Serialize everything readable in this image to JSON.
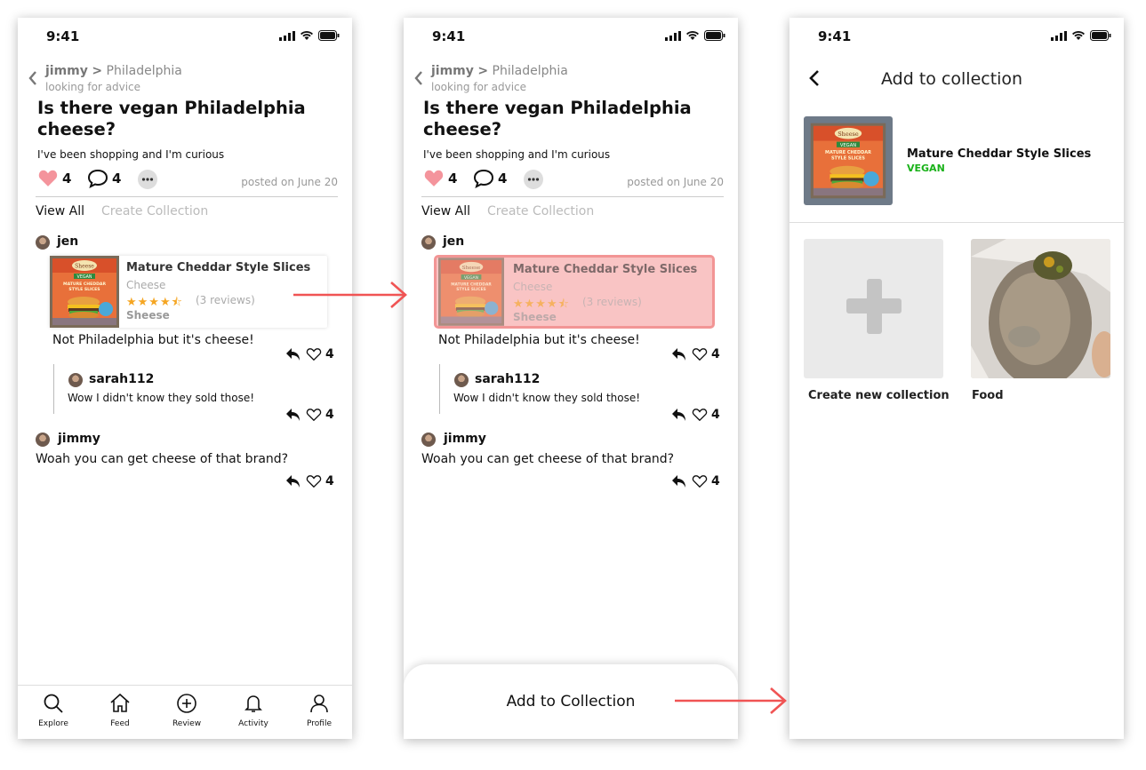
{
  "status": {
    "time": "9:41"
  },
  "post": {
    "author": "jimmy",
    "separator": ">",
    "community": "Philadelphia",
    "subtitle": "looking for advice",
    "title": "Is there vegan Philadelphia cheese?",
    "body": "I've been shopping and I'm curious",
    "likes": "4",
    "comments": "4",
    "posted": "posted on June 20"
  },
  "tabs": {
    "view_all": "View All",
    "create_collection": "Create Collection"
  },
  "comments": [
    {
      "user": "jen",
      "text": "Not Philadelphia but it's cheese!",
      "likes": "4"
    },
    {
      "user": "sarah112",
      "text": "Wow I didn't know they sold those!",
      "likes": "4"
    },
    {
      "user": "jimmy",
      "text": "Woah you can get cheese of that brand?",
      "likes": "4"
    }
  ],
  "product": {
    "name": "Mature Cheddar Style Slices",
    "category": "Cheese",
    "rating": 4.5,
    "stars": "★★★★⯪",
    "reviews": "(3 reviews)",
    "brand": "Sheese",
    "package": {
      "brand": "Sheese",
      "tag": "VEGAN",
      "line1": "MATURE CHEDDAR",
      "line2": "STYLE SLICES"
    }
  },
  "tabbar": [
    {
      "label": "Explore",
      "icon": "search-icon"
    },
    {
      "label": "Feed",
      "icon": "home-icon"
    },
    {
      "label": "Review",
      "icon": "plus-circle-icon"
    },
    {
      "label": "Activity",
      "icon": "bell-icon"
    },
    {
      "label": "Profile",
      "icon": "user-icon"
    }
  ],
  "sheet": {
    "action": "Add to Collection"
  },
  "collection_screen": {
    "title": "Add to collection",
    "product_name": "Mature Cheddar Style Slices",
    "product_tag": "VEGAN",
    "collections": [
      {
        "label": "Create new collection"
      },
      {
        "label": "Food"
      }
    ]
  },
  "colors": {
    "heart": "#f4949c",
    "highlight": "#f9c4c4",
    "arrow": "#f05454",
    "vegan": "#1ab21a",
    "stars": "#f5a623"
  }
}
